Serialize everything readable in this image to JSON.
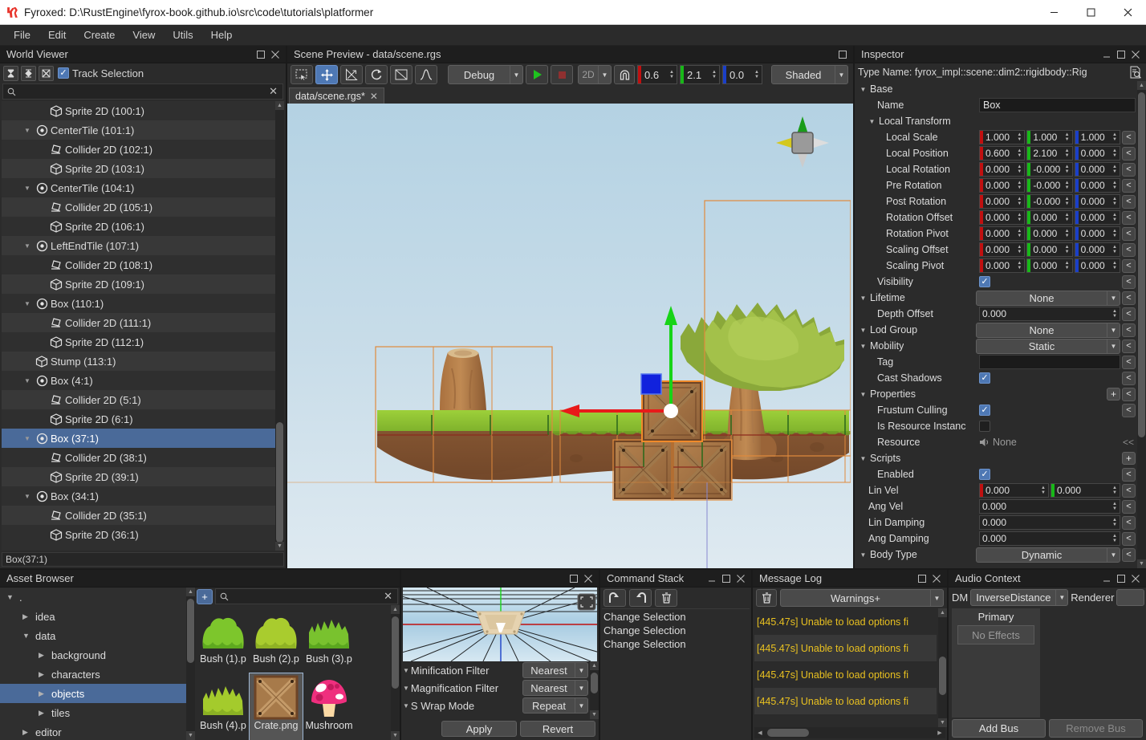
{
  "window": {
    "title": "Fyroxed: D:\\RustEngine\\fyrox-book.github.io\\src\\code\\tutorials\\platformer",
    "minimize": "—",
    "maximize": "□",
    "close": "✕"
  },
  "menu": {
    "items": [
      "File",
      "Edit",
      "Create",
      "View",
      "Utils",
      "Help"
    ]
  },
  "world_viewer": {
    "title": "World Viewer",
    "track_selection_label": "Track Selection",
    "track_selection_checked": true,
    "search_placeholder": "",
    "status": "Box(37:1)",
    "tree": [
      {
        "name": "Sprite 2D (100:1)",
        "indent": 2,
        "icon": "cube",
        "expand": "",
        "selected": false
      },
      {
        "name": "CenterTile (101:1)",
        "indent": 1,
        "icon": "pivot",
        "expand": "▼",
        "selected": false
      },
      {
        "name": "Collider 2D (102:1)",
        "indent": 2,
        "icon": "collider",
        "expand": "",
        "selected": false
      },
      {
        "name": "Sprite 2D (103:1)",
        "indent": 2,
        "icon": "cube",
        "expand": "",
        "selected": false
      },
      {
        "name": "CenterTile (104:1)",
        "indent": 1,
        "icon": "pivot",
        "expand": "▼",
        "selected": false
      },
      {
        "name": "Collider 2D (105:1)",
        "indent": 2,
        "icon": "collider",
        "expand": "",
        "selected": false
      },
      {
        "name": "Sprite 2D (106:1)",
        "indent": 2,
        "icon": "cube",
        "expand": "",
        "selected": false
      },
      {
        "name": "LeftEndTile (107:1)",
        "indent": 1,
        "icon": "pivot",
        "expand": "▼",
        "selected": false
      },
      {
        "name": "Collider 2D (108:1)",
        "indent": 2,
        "icon": "collider",
        "expand": "",
        "selected": false
      },
      {
        "name": "Sprite 2D (109:1)",
        "indent": 2,
        "icon": "cube",
        "expand": "",
        "selected": false
      },
      {
        "name": "Box (110:1)",
        "indent": 1,
        "icon": "pivot",
        "expand": "▼",
        "selected": false
      },
      {
        "name": "Collider 2D (111:1)",
        "indent": 2,
        "icon": "collider",
        "expand": "",
        "selected": false
      },
      {
        "name": "Sprite 2D (112:1)",
        "indent": 2,
        "icon": "cube",
        "expand": "",
        "selected": false
      },
      {
        "name": "Stump (113:1)",
        "indent": 1,
        "icon": "cube",
        "expand": "",
        "selected": false
      },
      {
        "name": "Box (4:1)",
        "indent": 1,
        "icon": "pivot",
        "expand": "▼",
        "selected": false
      },
      {
        "name": "Collider 2D (5:1)",
        "indent": 2,
        "icon": "collider",
        "expand": "",
        "selected": false
      },
      {
        "name": "Sprite 2D (6:1)",
        "indent": 2,
        "icon": "cube",
        "expand": "",
        "selected": false
      },
      {
        "name": "Box (37:1)",
        "indent": 1,
        "icon": "pivot",
        "expand": "▼",
        "selected": true
      },
      {
        "name": "Collider 2D (38:1)",
        "indent": 2,
        "icon": "collider",
        "expand": "",
        "selected": false
      },
      {
        "name": "Sprite 2D (39:1)",
        "indent": 2,
        "icon": "cube",
        "expand": "",
        "selected": false
      },
      {
        "name": "Box (34:1)",
        "indent": 1,
        "icon": "pivot",
        "expand": "▼",
        "selected": false
      },
      {
        "name": "Collider 2D (35:1)",
        "indent": 2,
        "icon": "collider",
        "expand": "",
        "selected": false
      },
      {
        "name": "Sprite 2D (36:1)",
        "indent": 2,
        "icon": "cube",
        "expand": "",
        "selected": false
      }
    ]
  },
  "scene_preview": {
    "title": "Scene Preview - data/scene.rgs",
    "tab_label": "data/scene.rgs*",
    "tools": [
      "select-icon",
      "move-icon",
      "scale-icon",
      "rotate-icon",
      "navmesh-icon",
      "terrain-icon"
    ],
    "mode_combo": "Debug",
    "play_label": "▶",
    "stop_label": "■",
    "dim_combo": "2D",
    "snap_icon": "magnet-icon",
    "snap_x": "0.6",
    "snap_y": "2.1",
    "snap_z": "0.0",
    "render_combo": "Shaded"
  },
  "inspector": {
    "title": "Inspector",
    "type_name": "Type Name: fyrox_impl::scene::dim2::rigidbody::Rig",
    "rows": [
      {
        "kind": "group",
        "label": "Base",
        "indent": 0,
        "expand": "▼"
      },
      {
        "kind": "text",
        "label": "Name",
        "indent": 1,
        "value": "Box"
      },
      {
        "kind": "group",
        "label": "Local Transform",
        "indent": 1,
        "expand": "▼"
      },
      {
        "kind": "vec3",
        "label": "Local Scale",
        "indent": 2,
        "values": [
          "1.000",
          "1.000",
          "1.000"
        ]
      },
      {
        "kind": "vec3",
        "label": "Local Position",
        "indent": 2,
        "values": [
          "0.600",
          "2.100",
          "0.000"
        ]
      },
      {
        "kind": "vec3",
        "label": "Local Rotation",
        "indent": 2,
        "values": [
          "0.000",
          "-0.000",
          "0.000"
        ]
      },
      {
        "kind": "vec3",
        "label": "Pre Rotation",
        "indent": 2,
        "values": [
          "0.000",
          "-0.000",
          "0.000"
        ]
      },
      {
        "kind": "vec3",
        "label": "Post Rotation",
        "indent": 2,
        "values": [
          "0.000",
          "-0.000",
          "0.000"
        ]
      },
      {
        "kind": "vec3",
        "label": "Rotation Offset",
        "indent": 2,
        "values": [
          "0.000",
          "0.000",
          "0.000"
        ]
      },
      {
        "kind": "vec3",
        "label": "Rotation Pivot",
        "indent": 2,
        "values": [
          "0.000",
          "0.000",
          "0.000"
        ]
      },
      {
        "kind": "vec3",
        "label": "Scaling Offset",
        "indent": 2,
        "values": [
          "0.000",
          "0.000",
          "0.000"
        ]
      },
      {
        "kind": "vec3",
        "label": "Scaling Pivot",
        "indent": 2,
        "values": [
          "0.000",
          "0.000",
          "0.000"
        ]
      },
      {
        "kind": "check",
        "label": "Visibility",
        "indent": 1,
        "checked": true
      },
      {
        "kind": "combo",
        "label": "Lifetime",
        "indent": 0,
        "expand": "▼",
        "value": "None"
      },
      {
        "kind": "num",
        "label": "Depth Offset",
        "indent": 1,
        "value": "0.000"
      },
      {
        "kind": "combo",
        "label": "Lod Group",
        "indent": 0,
        "expand": "▼",
        "value": "None"
      },
      {
        "kind": "combo",
        "label": "Mobility",
        "indent": 0,
        "expand": "▼",
        "value": "Static"
      },
      {
        "kind": "text",
        "label": "Tag",
        "indent": 1,
        "value": ""
      },
      {
        "kind": "check",
        "label": "Cast Shadows",
        "indent": 1,
        "checked": true
      },
      {
        "kind": "groupplus",
        "label": "Properties",
        "indent": 0,
        "expand": "▼"
      },
      {
        "kind": "check",
        "label": "Frustum Culling",
        "indent": 1,
        "checked": true
      },
      {
        "kind": "checksmall",
        "label": "Is Resource Instanc",
        "indent": 1,
        "checked": false
      },
      {
        "kind": "resource",
        "label": "Resource",
        "indent": 1,
        "value": "None",
        "more": "<<"
      },
      {
        "kind": "groupplusonly",
        "label": "Scripts",
        "indent": 0,
        "expand": "▼"
      },
      {
        "kind": "check",
        "label": "Enabled",
        "indent": 1,
        "checked": true
      },
      {
        "kind": "vec2",
        "label": "Lin Vel",
        "indent": 0,
        "values": [
          "0.000",
          "0.000"
        ]
      },
      {
        "kind": "num",
        "label": "Ang Vel",
        "indent": 0,
        "value": "0.000"
      },
      {
        "kind": "num",
        "label": "Lin Damping",
        "indent": 0,
        "value": "0.000"
      },
      {
        "kind": "num",
        "label": "Ang Damping",
        "indent": 0,
        "value": "0.000"
      },
      {
        "kind": "combo",
        "label": "Body Type",
        "indent": 0,
        "expand": "▼",
        "value": "Dynamic"
      }
    ]
  },
  "asset_browser": {
    "title": "Asset Browser",
    "search_placeholder": "",
    "add_label": "+",
    "tree": [
      {
        "name": ".",
        "indent": 0,
        "expand": "▼",
        "selected": false
      },
      {
        "name": "idea",
        "indent": 1,
        "expand": "▶",
        "selected": false
      },
      {
        "name": "data",
        "indent": 1,
        "expand": "▼",
        "selected": false
      },
      {
        "name": "background",
        "indent": 2,
        "expand": "▶",
        "selected": false
      },
      {
        "name": "characters",
        "indent": 2,
        "expand": "▶",
        "selected": false
      },
      {
        "name": "objects",
        "indent": 2,
        "expand": "▶",
        "selected": true
      },
      {
        "name": "tiles",
        "indent": 2,
        "expand": "▶",
        "selected": false
      },
      {
        "name": "editor",
        "indent": 1,
        "expand": "▶",
        "selected": false
      }
    ],
    "assets": [
      {
        "name": "Bush (1).p",
        "icon": "bush-a",
        "selected": false
      },
      {
        "name": "Bush (2).p",
        "icon": "bush-b",
        "selected": false
      },
      {
        "name": "Bush (3).p",
        "icon": "bush-c",
        "selected": false
      },
      {
        "name": "Bush (4).p",
        "icon": "bush-d",
        "selected": false
      },
      {
        "name": "Crate.png",
        "icon": "crate",
        "selected": true
      },
      {
        "name": "Mushroom",
        "icon": "mushroom",
        "selected": false
      }
    ]
  },
  "preview_panel": {
    "title": "",
    "rows": [
      {
        "label": "Minification Filter",
        "value": "Nearest"
      },
      {
        "label": "Magnification Filter",
        "value": "Nearest"
      },
      {
        "label": "S Wrap Mode",
        "value": "Repeat"
      }
    ],
    "apply_label": "Apply",
    "revert_label": "Revert"
  },
  "command_stack": {
    "title": "Command Stack",
    "undo_icon": "undo-icon",
    "redo_icon": "redo-icon",
    "clear_icon": "trash-icon",
    "items": [
      "Change Selection",
      "Change Selection",
      "Change Selection"
    ]
  },
  "message_log": {
    "title": "Message Log",
    "clear_icon": "trash-icon",
    "filter": "Warnings+",
    "items": [
      "[445.47s] Unable to load options fi",
      "[445.47s] Unable to load options fi",
      "[445.47s] Unable to load options fi",
      "[445.47s] Unable to load options fi"
    ]
  },
  "audio_context": {
    "title": "Audio Context",
    "dm_label": "DM",
    "distance_model": "InverseDistance",
    "renderer_label": "Renderer",
    "renderer_value": "",
    "bus_name": "Primary",
    "no_effects": "No Effects",
    "add_bus": "Add Bus",
    "remove_bus": "Remove Bus"
  },
  "colors": {
    "accent": "#4e78b4",
    "warning": "#e8c020",
    "axis_x": "#c01010",
    "axis_y": "#18b818",
    "axis_z": "#1a3fc8",
    "selection_outline": "#e08a3c"
  }
}
